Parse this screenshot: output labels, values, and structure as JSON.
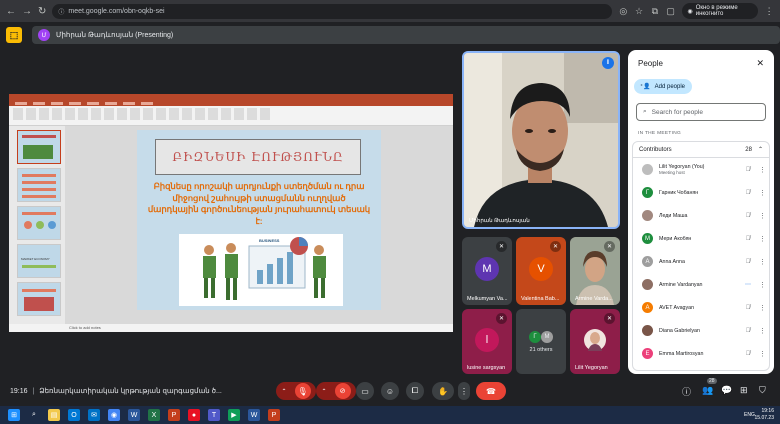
{
  "browser": {
    "url": "meet.google.com/obn-oqkb-sei",
    "incognito_label": "Окно в режиме инкогнито"
  },
  "meet": {
    "presenter_chip": "Միհրան Թադևոսյան (Presenting)",
    "presenter_initial": "Մ"
  },
  "slide": {
    "title": "ԲԻԶՆԵՍԻ ԷՈՒԹՅՈՒՆԸ",
    "body": "Բիզնեսը որոշակի արդյունքի ստեղծման ու դրա միջոցով շահույթի ստացմանն ուղղված մարդկային գործունեության յուրահատուկ տեսակ է:",
    "image_caption": "BUSINESS",
    "status_text": "Click to add notes",
    "thumb_labels": [
      "ԲԻԶՆԵՍԻ ԷՈՒԹՅՈՒՆԸ",
      "MARKET ECONOMY"
    ]
  },
  "main_speaker": {
    "name": "Միհրան Թադևոսյան"
  },
  "tiles": [
    {
      "name": "Melkumyan Va...",
      "initial": "M",
      "color": "#5e35b1"
    },
    {
      "name": "Valentina Bab...",
      "initial": "V",
      "color": "#e65100"
    },
    {
      "name": "Armine Varda...",
      "initial": "",
      "color": "#8d6e63"
    },
    {
      "name": "lusine sargsyan",
      "initial": "l",
      "color": "#c2185b"
    },
    {
      "name": "21 others",
      "initial": "",
      "color": "#3c4043"
    },
    {
      "name": "Lilit Yegoryan",
      "initial": "",
      "color": "#c2185b"
    }
  ],
  "others_avatars": [
    "Г",
    "M"
  ],
  "people_panel": {
    "title": "People",
    "add_people": "Add people",
    "search_placeholder": "Search for people",
    "section": "IN THE MEETING",
    "contributors_label": "Contributors",
    "contributors_count": "28",
    "participants": [
      {
        "name": "Lilit Yegoryan (You)",
        "sub": "Meeting host",
        "initial": "",
        "color": "#bdbdbd"
      },
      {
        "name": "Гарник Чобанян",
        "sub": "",
        "initial": "Г",
        "color": "#1e8e3e"
      },
      {
        "name": "Леди Маша",
        "sub": "",
        "initial": "",
        "color": "#a1887f"
      },
      {
        "name": "Мери Акобян",
        "sub": "",
        "initial": "М",
        "color": "#1e8e3e"
      },
      {
        "name": "Anna Anna",
        "sub": "",
        "initial": "A",
        "color": "#9e9e9e"
      },
      {
        "name": "Armine Vardanyan",
        "sub": "",
        "initial": "",
        "color": "#8d6e63"
      },
      {
        "name": "AVET Avagyan",
        "sub": "",
        "initial": "A",
        "color": "#f57c00"
      },
      {
        "name": "Diana Gabrielyan",
        "sub": "",
        "initial": "",
        "color": "#795548"
      },
      {
        "name": "Emma Martirosyan",
        "sub": "",
        "initial": "E",
        "color": "#ec407a"
      }
    ]
  },
  "bottom_bar": {
    "time": "19:16",
    "meeting_title": "Ձեռնարկատիրական կրթության զարգացման ծ...",
    "people_badge": "28"
  },
  "taskbar": {
    "time": "19:16",
    "date": "15.07.23",
    "lang": "ENG"
  },
  "colors": {
    "accent_blue": "#8ab4f8",
    "end_call": "#ea4335",
    "muted_red": "#8c1d18"
  }
}
